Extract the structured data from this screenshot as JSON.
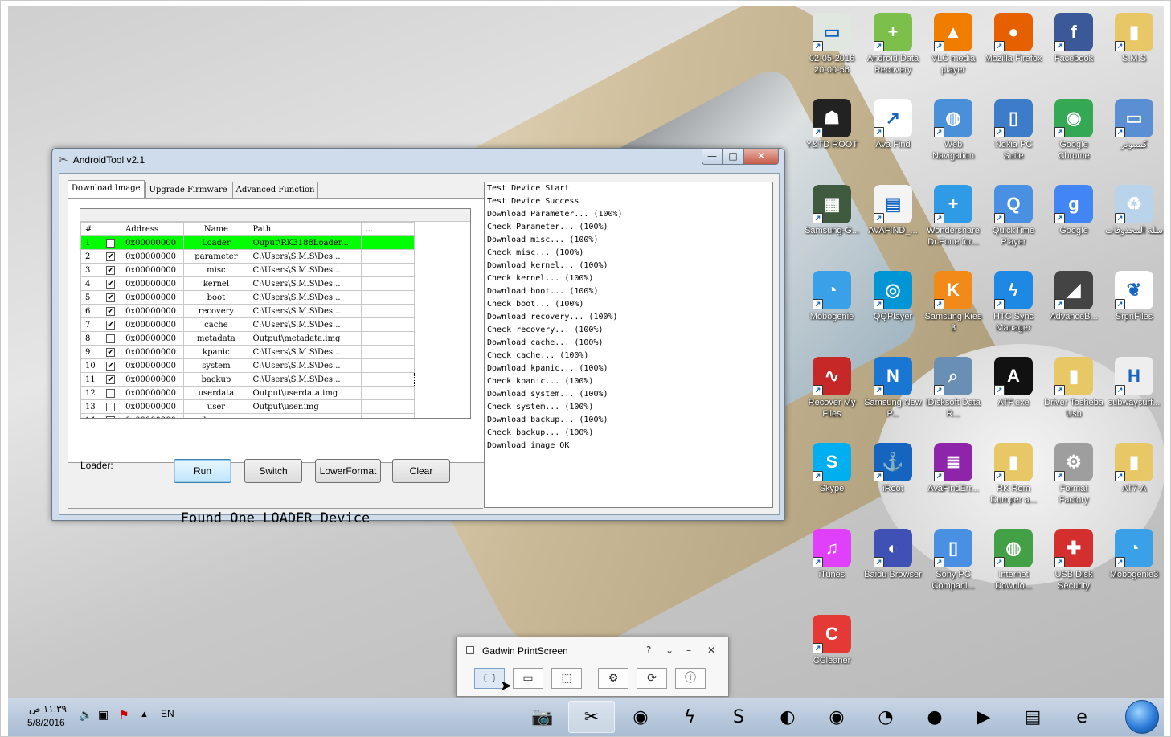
{
  "desktop_icons": [
    {
      "label": "02-05-2016 20-00-56",
      "icon": "file-image-icon",
      "color": "#e0e6e0",
      "glyph": "▭"
    },
    {
      "label": "Android Data Recovery",
      "icon": "android-data-recovery-icon",
      "color": "#7cbf4a",
      "glyph": "+"
    },
    {
      "label": "VLC media player",
      "icon": "vlc-icon",
      "color": "#f07c00",
      "glyph": "▲"
    },
    {
      "label": "Mozilla Firefox",
      "icon": "firefox-icon",
      "color": "#e66000",
      "glyph": "●"
    },
    {
      "label": "Facebook",
      "icon": "facebook-icon",
      "color": "#3b5998",
      "glyph": "f"
    },
    {
      "label": "S.M.S",
      "icon": "user-folder-icon",
      "color": "#e8c766",
      "glyph": "▮"
    },
    {
      "label": "Y&TD ROOT",
      "icon": "android-root-icon",
      "color": "#222222",
      "glyph": "☗"
    },
    {
      "label": "Ava Find",
      "icon": "ava-find-icon",
      "color": "#ffffff",
      "glyph": "↗"
    },
    {
      "label": "Web Navigation",
      "icon": "globe-icon",
      "color": "#4a90d9",
      "glyph": "◍"
    },
    {
      "label": "Nokia PC Suite",
      "icon": "nokia-suite-icon",
      "color": "#3d7cc9",
      "glyph": "▯"
    },
    {
      "label": "Google Chrome",
      "icon": "chrome-icon",
      "color": "#34a853",
      "glyph": "◉"
    },
    {
      "label": "كمبيوتر",
      "icon": "computer-icon",
      "color": "#5b8fd4",
      "glyph": "▭"
    },
    {
      "label": "Samsung-G...",
      "icon": "samsung-board-icon",
      "color": "#3f5a3f",
      "glyph": "▦"
    },
    {
      "label": "AVAFIND_...",
      "icon": "document-icon",
      "color": "#f4f4f4",
      "glyph": "▤"
    },
    {
      "label": "Wondershare Dr.Fone for...",
      "icon": "drfone-icon",
      "color": "#2f9be6",
      "glyph": "+"
    },
    {
      "label": "QuickTime Player",
      "icon": "quicktime-icon",
      "color": "#4a90e2",
      "glyph": "Q"
    },
    {
      "label": "Google",
      "icon": "google-icon",
      "color": "#4285f4",
      "glyph": "g"
    },
    {
      "label": "سلة المحذوفات",
      "icon": "recycle-bin-icon",
      "color": "#b8d3ea",
      "glyph": "♻"
    },
    {
      "label": "Mobogenie",
      "icon": "mobogenie-icon",
      "color": "#3aa0e8",
      "glyph": "◔"
    },
    {
      "label": "QQPlayer",
      "icon": "qqplayer-icon",
      "color": "#0096d6",
      "glyph": "◎"
    },
    {
      "label": "Samsung Kies 3",
      "icon": "kies-icon",
      "color": "#f28a1a",
      "glyph": "K"
    },
    {
      "label": "HTC Sync Manager",
      "icon": "htc-sync-icon",
      "color": "#1e88e5",
      "glyph": "ϟ"
    },
    {
      "label": "AdvanceB...",
      "icon": "advance-icon",
      "color": "#444444",
      "glyph": "◢"
    },
    {
      "label": "SrpnFiles",
      "icon": "srpnfiles-icon",
      "color": "#ffffff",
      "glyph": "❦"
    },
    {
      "label": "Recover My Files",
      "icon": "recover-my-files-icon",
      "color": "#c62828",
      "glyph": "∿"
    },
    {
      "label": "Samsung New P...",
      "icon": "samsung-nps-icon",
      "color": "#1976d2",
      "glyph": "N"
    },
    {
      "label": "iDisksoft Data R...",
      "icon": "idisksoft-icon",
      "color": "#6a8fb5",
      "glyph": "⌕"
    },
    {
      "label": "ATF.exe",
      "icon": "atf-icon",
      "color": "#111111",
      "glyph": "A"
    },
    {
      "label": "Driver Tosheba Usb",
      "icon": "folder-icon",
      "color": "#e8c766",
      "glyph": "▮"
    },
    {
      "label": "subwaysurf...",
      "icon": "subway-file-icon",
      "color": "#eeeeee",
      "glyph": "H"
    },
    {
      "label": "Skype",
      "icon": "skype-icon",
      "color": "#00aff0",
      "glyph": "S"
    },
    {
      "label": "iRoot",
      "icon": "iroot-icon",
      "color": "#1565c0",
      "glyph": "⚓"
    },
    {
      "label": "AvaFindErr...",
      "icon": "winrar-icon",
      "color": "#8e24aa",
      "glyph": "≣"
    },
    {
      "label": "RK Rom Dumper a...",
      "icon": "folder-icon",
      "color": "#e8c766",
      "glyph": "▮"
    },
    {
      "label": "Format Factory",
      "icon": "format-factory-icon",
      "color": "#9e9e9e",
      "glyph": "⚙"
    },
    {
      "label": "AT7-A",
      "icon": "folder-icon",
      "color": "#e8c766",
      "glyph": "▮"
    },
    {
      "label": "iTunes",
      "icon": "itunes-icon",
      "color": "#e040fb",
      "glyph": "♫"
    },
    {
      "label": "Baidu Browser",
      "icon": "baidu-browser-icon",
      "color": "#3f51b5",
      "glyph": "◐"
    },
    {
      "label": "Sony PC Compani...",
      "icon": "sony-pc-companion-icon",
      "color": "#4a90e2",
      "glyph": "▯"
    },
    {
      "label": "Internet Downlo...",
      "icon": "idm-icon",
      "color": "#43a047",
      "glyph": "◍"
    },
    {
      "label": "USB Disk Security",
      "icon": "usb-disk-security-icon",
      "color": "#d32f2f",
      "glyph": "✚"
    },
    {
      "label": "Mobogenie3",
      "icon": "mobogenie-icon",
      "color": "#3aa0e8",
      "glyph": "◔"
    },
    {
      "label": "CCleaner",
      "icon": "ccleaner-icon",
      "color": "#e53935",
      "glyph": "C"
    }
  ],
  "window": {
    "title": "AndroidTool v2.1",
    "tabs": [
      "Download Image",
      "Upgrade Firmware",
      "Advanced Function"
    ],
    "grid_headers": [
      "#",
      "",
      "Address",
      "Name",
      "Path",
      "..."
    ],
    "rows": [
      {
        "n": "1",
        "checked": false,
        "addr": "0x00000000",
        "name": "Loader",
        "path": "Ouput\\RK3188Loader...",
        "hl": true
      },
      {
        "n": "2",
        "checked": true,
        "addr": "0x00000000",
        "name": "parameter",
        "path": "C:\\Users\\S.M.S\\Des..."
      },
      {
        "n": "3",
        "checked": true,
        "addr": "0x00000000",
        "name": "misc",
        "path": "C:\\Users\\S.M.S\\Des..."
      },
      {
        "n": "4",
        "checked": true,
        "addr": "0x00000000",
        "name": "kernel",
        "path": "C:\\Users\\S.M.S\\Des..."
      },
      {
        "n": "5",
        "checked": true,
        "addr": "0x00000000",
        "name": "boot",
        "path": "C:\\Users\\S.M.S\\Des..."
      },
      {
        "n": "6",
        "checked": true,
        "addr": "0x00000000",
        "name": "recovery",
        "path": "C:\\Users\\S.M.S\\Des..."
      },
      {
        "n": "7",
        "checked": true,
        "addr": "0x00000000",
        "name": "cache",
        "path": "C:\\Users\\S.M.S\\Des..."
      },
      {
        "n": "8",
        "checked": false,
        "addr": "0x00000000",
        "name": "metadata",
        "path": "Output\\metadata.img"
      },
      {
        "n": "9",
        "checked": true,
        "addr": "0x00000000",
        "name": "kpanic",
        "path": "C:\\Users\\S.M.S\\Des..."
      },
      {
        "n": "10",
        "checked": true,
        "addr": "0x00000000",
        "name": "system",
        "path": "C:\\Users\\S.M.S\\Des..."
      },
      {
        "n": "11",
        "checked": true,
        "addr": "0x00000000",
        "name": "backup",
        "path": "C:\\Users\\S.M.S\\Des..."
      },
      {
        "n": "12",
        "checked": false,
        "addr": "0x00000000",
        "name": "userdata",
        "path": "Output\\userdata.img"
      },
      {
        "n": "13",
        "checked": false,
        "addr": "0x00000000",
        "name": "user",
        "path": "Output\\user.img"
      },
      {
        "n": "14",
        "checked": false,
        "addr": "0x00000000",
        "name": "dummy",
        "path": ""
      }
    ],
    "loader_label": "Loader:",
    "buttons": {
      "run": "Run",
      "switch": "Switch",
      "lowerformat": "LowerFormat",
      "clear": "Clear"
    },
    "status": "Found One LOADER Device",
    "log": [
      "Test Device Start",
      "Test Device Success",
      "Download Parameter... (100%)",
      "Check Parameter... (100%)",
      "Download misc... (100%)",
      "Check misc... (100%)",
      "Download kernel... (100%)",
      "Check kernel... (100%)",
      "Download boot... (100%)",
      "Check boot... (100%)",
      "Download recovery... (100%)",
      "Check recovery... (100%)",
      "Download cache... (100%)",
      "Check cache... (100%)",
      "Download kpanic... (100%)",
      "Check kpanic... (100%)",
      "Download system... (100%)",
      "Check system... (100%)",
      "Download backup... (100%)",
      "Check backup... (100%)",
      "Download image OK"
    ],
    "controls": {
      "minimize": "—",
      "maximize": "□",
      "close": "✕"
    },
    "highlight_color": "#00ff00"
  },
  "gadwin": {
    "title": "Gadwin PrintScreen",
    "controls": {
      "help": "?",
      "dropdown": "⌄",
      "minimize": "–",
      "close": "✕"
    },
    "buttons": [
      {
        "name": "full-screen-capture-button",
        "glyph": "🖵"
      },
      {
        "name": "window-capture-button",
        "glyph": "▭"
      },
      {
        "name": "region-capture-button",
        "glyph": "⬚"
      },
      {
        "name": "settings-button",
        "glyph": "⚙"
      },
      {
        "name": "update-button",
        "glyph": "⟳"
      },
      {
        "name": "about-button",
        "glyph": "ⓘ"
      }
    ]
  },
  "taskbar": {
    "time": "١١:٣٩ ص",
    "date": "5/8/2016",
    "language": "EN",
    "items": [
      {
        "name": "camera-app-icon",
        "glyph": "📷",
        "active": false
      },
      {
        "name": "androidtool-task-icon",
        "glyph": "✂",
        "active": true
      },
      {
        "name": "chrome-task-icon",
        "glyph": "◉",
        "active": false
      },
      {
        "name": "htc-sync-task-icon",
        "glyph": "ϟ",
        "active": false
      },
      {
        "name": "skype-task-icon",
        "glyph": "S",
        "active": false
      },
      {
        "name": "baidu-task-icon",
        "glyph": "◐",
        "active": false
      },
      {
        "name": "chrome2-task-icon",
        "glyph": "◉",
        "active": false
      },
      {
        "name": "mobogenie-task-icon",
        "glyph": "◔",
        "active": false
      },
      {
        "name": "firefox-task-icon",
        "glyph": "●",
        "active": false
      },
      {
        "name": "media-player-task-icon",
        "glyph": "▶",
        "active": false
      },
      {
        "name": "explorer-task-icon",
        "glyph": "▤",
        "active": false
      },
      {
        "name": "ie-task-icon",
        "glyph": "e",
        "active": false
      }
    ]
  }
}
